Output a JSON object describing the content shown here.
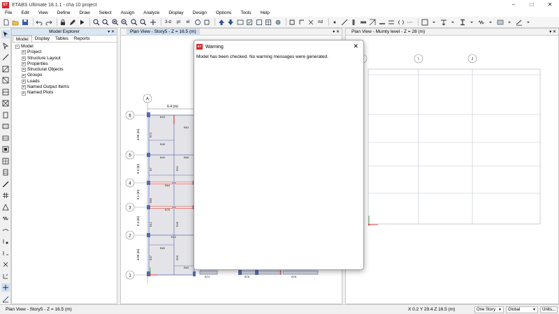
{
  "app": {
    "logo": "ET",
    "title": "ETABS Ultimate 18.1.1 - cha 10 project"
  },
  "window_controls": {
    "minimize": "–",
    "maximize": "□",
    "close": "✕"
  },
  "menu": [
    "File",
    "Edit",
    "View",
    "Define",
    "Draw",
    "Select",
    "Assign",
    "Analyze",
    "Display",
    "Design",
    "Options",
    "Tools",
    "Help"
  ],
  "toolbar": {
    "view_3d_label": "3-d",
    "plan_label": "pl",
    "elev_label": "el",
    "nd_label": "nd"
  },
  "model_explorer": {
    "title": "Model Explorer",
    "tabs": [
      "Model",
      "Display",
      "Tables",
      "Reports"
    ],
    "root": "Model",
    "items": [
      "Project",
      "Structure Layout",
      "Properties",
      "Structural Objects",
      "Groups",
      "Loads",
      "Named Output Items",
      "Named Plots"
    ]
  },
  "plan_view": {
    "tab": "Plan View - Story5 - Z = 16.5 (m)",
    "grid_col_a": "A",
    "grid_rows": [
      "6",
      "5",
      "4",
      "3",
      "2",
      "1"
    ],
    "dim_top": "6.4 (m)",
    "dim_vertical": [
      "4.05 (m)",
      "3.4 (m)",
      "3.1 (m)",
      "3.4 (m)",
      "4.05 (m)"
    ],
    "beam_labels": [
      "B43",
      "B63",
      "B46",
      "B49",
      "B58",
      "B64",
      "B75",
      "B12",
      "B69",
      "B65",
      "B74",
      "B76",
      "B78"
    ],
    "column_labels": [
      "B74",
      "B7",
      "B80",
      "B12",
      "B37",
      "B31",
      "B28",
      "B26"
    ]
  },
  "mumty_view": {
    "tab": "Plan View - Mumty level - Z = 28 (m)",
    "grid_bubbles": [
      "H",
      "I",
      "J"
    ]
  },
  "warning_dialog": {
    "logo": "ET",
    "title": "Warning",
    "close": "✕",
    "message": "Model has been checked.  No warning messages were generated."
  },
  "status": {
    "view_label": "Plan View - Story5 - Z = 16.5 (m)",
    "coordinates": "X 0.2  Y 29.4  Z 16.5 (m)",
    "story_select": "One Story",
    "coord_system": "Global",
    "units_button": "Units..."
  },
  "colors": {
    "beam": "#5b6fb5",
    "column": "#5a6aa8",
    "wall_red": "#e0453a",
    "grid_line": "#9aa0a8",
    "dialog_logo": "#d6262b"
  }
}
